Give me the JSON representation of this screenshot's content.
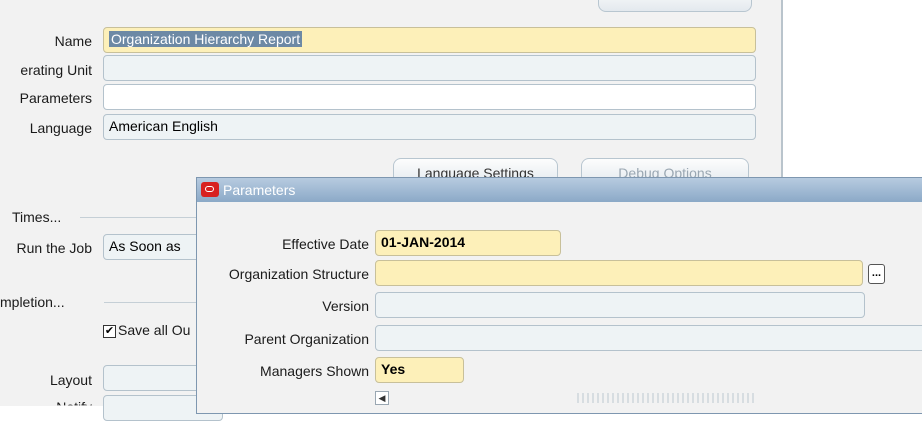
{
  "form": {
    "name_label": "Name",
    "name_value": "Organization Hierarchy Report",
    "operating_unit_label": "erating Unit",
    "operating_unit_value": "",
    "parameters_label": "Parameters",
    "parameters_value": "",
    "language_label": "Language",
    "language_value": "American English",
    "language_settings_button": "Language Settings",
    "debug_options_button": "Debug Options",
    "times_heading": "Times...",
    "run_job_label": "Run the Job",
    "run_job_value": "As Soon as",
    "completion_heading": "mpletion...",
    "save_all_label": "Save all Ou",
    "save_all_checked": true,
    "layout_label": "Layout",
    "notify_label": "Notify"
  },
  "modal": {
    "title": "Parameters",
    "effective_date_label": "Effective Date",
    "effective_date_value": "01-JAN-2014",
    "org_structure_label": "Organization Structure",
    "org_structure_value": "",
    "lov_glyph": "...",
    "version_label": "Version",
    "version_value": "",
    "parent_org_label": "Parent Organization",
    "parent_org_value": "",
    "managers_shown_label": "Managers Shown",
    "managers_shown_value": "Yes",
    "scroll_left_glyph": "◀"
  },
  "colors": {
    "required_field": "#fdf0b9",
    "title_bar": "#8ba9c7",
    "oracle_icon": "#d82020"
  }
}
